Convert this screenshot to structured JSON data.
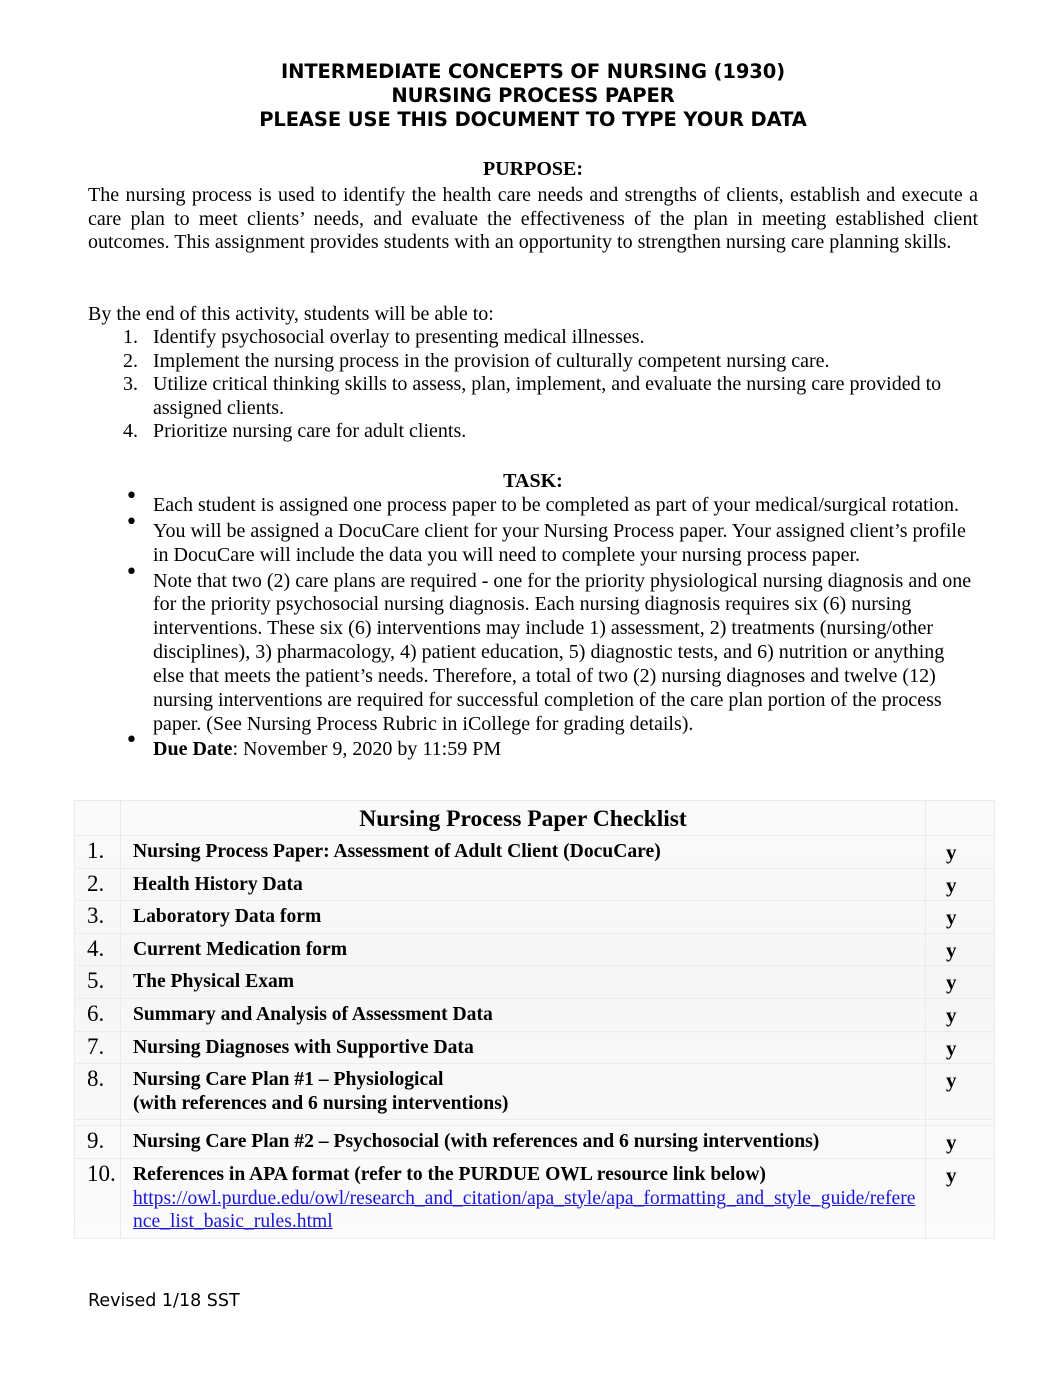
{
  "document": {
    "title_lines": [
      "INTERMEDIATE CONCEPTS OF NURSING (1930)",
      "NURSING PROCESS PAPER",
      "PLEASE USE THIS DOCUMENT TO TYPE YOUR DATA"
    ],
    "purpose": {
      "heading": "PURPOSE:",
      "paragraph": "The nursing process is used to identify the health care needs and strengths of clients, establish and execute a care plan to meet clients’ needs, and evaluate the effectiveness of the plan in meeting established client outcomes. This assignment provides students with an opportunity to strengthen nursing care planning skills."
    },
    "objectives": {
      "intro": "By the end of this activity, students will be able to:",
      "items": [
        {
          "num": "1.",
          "text": "Identify psychosocial overlay to presenting medical illnesses."
        },
        {
          "num": "2.",
          "text": "Implement the nursing process in the provision of culturally competent nursing care."
        },
        {
          "num": "3.",
          "text": "Utilize critical thinking skills to assess, plan, implement, and evaluate the nursing care provided to assigned clients."
        },
        {
          "num": "4.",
          "text": "Prioritize nursing care for adult clients."
        }
      ]
    },
    "task": {
      "heading": "TASK:",
      "bullet_glyph": "•",
      "items": [
        {
          "text": "Each student is assigned one process paper to be completed as part of your medical/surgical rotation."
        },
        {
          "text": "You will be assigned a DocuCare client for your Nursing Process paper. Your assigned client’s profile in DocuCare will include the data you will need to complete your nursing process paper."
        },
        {
          "text": "Note that two (2) care plans are required - one for the priority physiological nursing diagnosis and one for the priority psychosocial nursing diagnosis.  Each nursing diagnosis requires six (6) nursing interventions. These six (6) interventions may include 1) assessment, 2) treatments (nursing/other disciplines), 3) pharmacology, 4) patient education, 5) diagnostic tests, and 6) nutrition or anything else that meets the patient’s needs. Therefore, a total of two (2) nursing diagnoses and twelve (12) nursing interventions are required for successful completion of the care plan portion of the process paper. (See Nursing Process Rubric in iCollege for grading details)."
        },
        {
          "label": "Due Date",
          "text": ": November 9, 2020 by 11:59 PM"
        }
      ]
    },
    "checklist": {
      "header": "Nursing Process Paper Checklist",
      "check_mark": "y",
      "rows": [
        {
          "num": "1.",
          "item": "Nursing Process Paper: Assessment of Adult Client (DocuCare)",
          "check": "y"
        },
        {
          "num": "2.",
          "item": "Health History Data",
          "check": "y"
        },
        {
          "num": "3.",
          "item": "Laboratory Data form",
          "check": "y"
        },
        {
          "num": "4.",
          "item": "Current Medication form",
          "check": "y"
        },
        {
          "num": "5.",
          "item": "The Physical Exam",
          "check": "y"
        },
        {
          "num": "6.",
          "item": "Summary and Analysis of Assessment Data",
          "check": "y"
        },
        {
          "num": "7.",
          "item": "Nursing Diagnoses with Supportive Data",
          "check": "y"
        },
        {
          "num": "8.",
          "item": "Nursing Care Plan #1 – Physiological",
          "item_line2": "(with references and 6 nursing interventions)",
          "check": "y"
        },
        {
          "num": "9.",
          "item": "Nursing Care Plan #2 – Psychosocial (with references and 6 nursing interventions)",
          "check": "y"
        },
        {
          "num": "10.",
          "item": "References in APA format (refer to the PURDUE OWL resource link below)",
          "url": "https://owl.purdue.edu/owl/research_and_citation/apa_style/apa_formatting_and_style_guide/reference_list_basic_rules.html",
          "check": "y"
        }
      ]
    },
    "footer": {
      "revised": "Revised 1/18 SST"
    },
    "colors": {
      "link": "#1a16d8",
      "text": "#000000",
      "table_background": "#f8f8f8",
      "table_border": "#ebebeb"
    }
  }
}
